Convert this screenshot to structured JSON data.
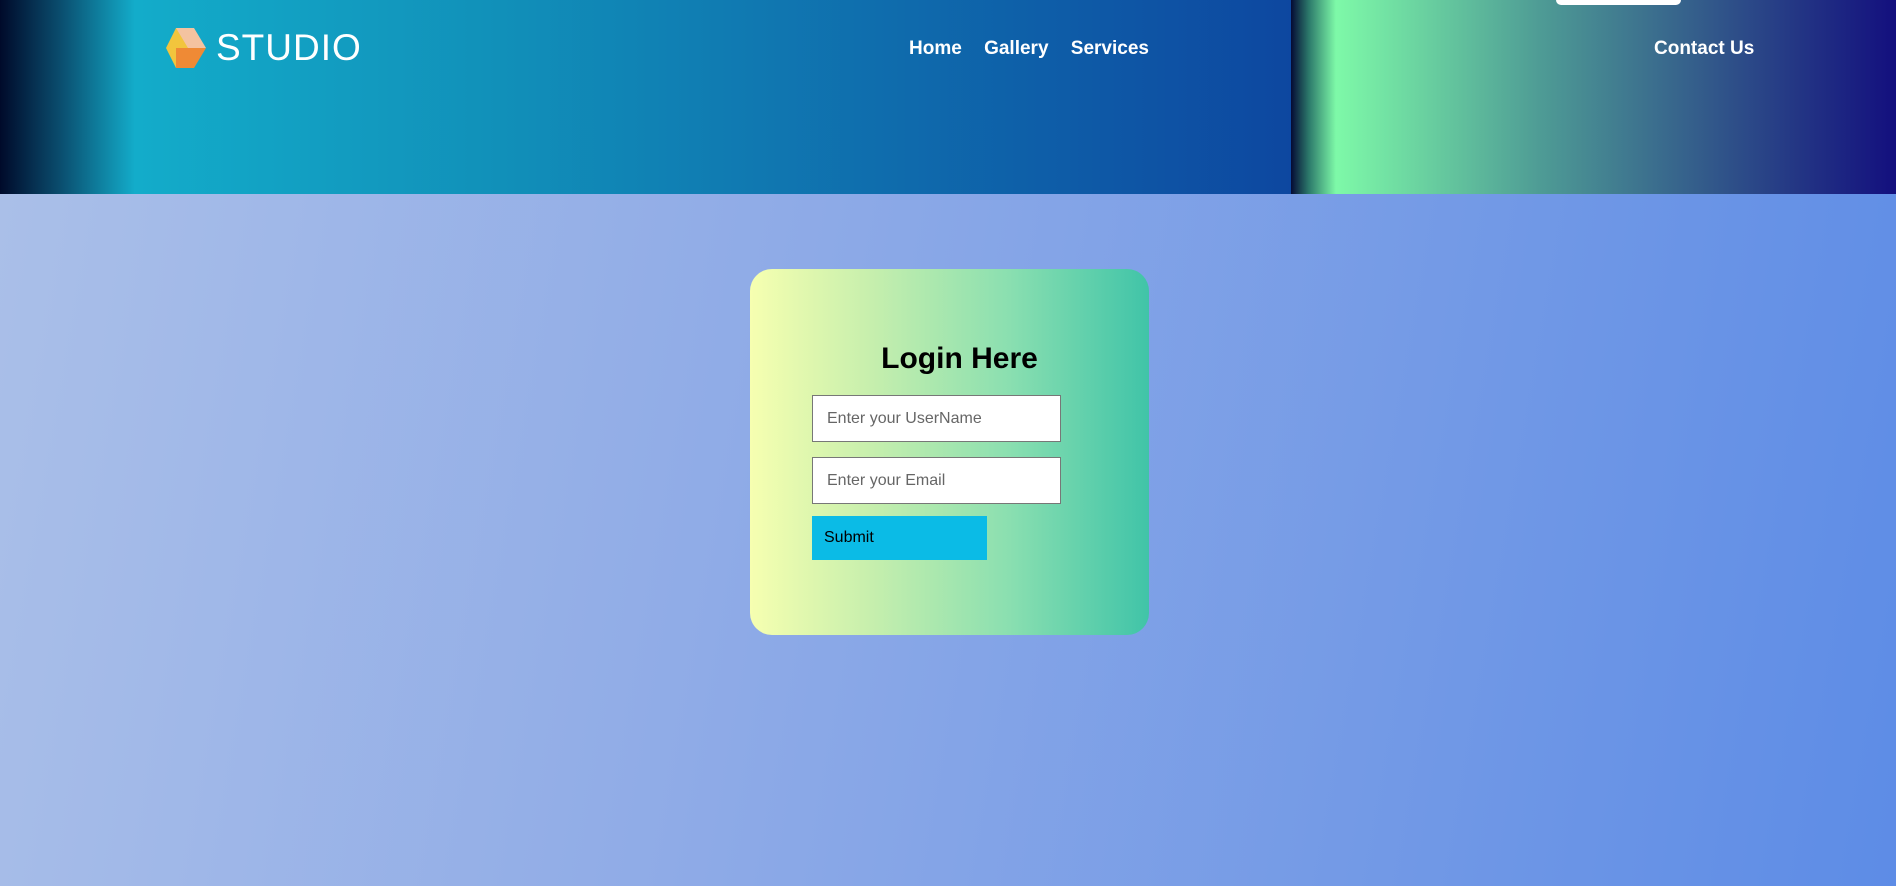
{
  "header": {
    "logo_text": "STUDIO",
    "nav": [
      "Home",
      "Gallery",
      "Services"
    ],
    "contact": "Contact Us"
  },
  "login": {
    "title": "Login Here",
    "username_placeholder": "Enter your UserName",
    "email_placeholder": "Enter your Email",
    "submit_label": "Submit"
  }
}
